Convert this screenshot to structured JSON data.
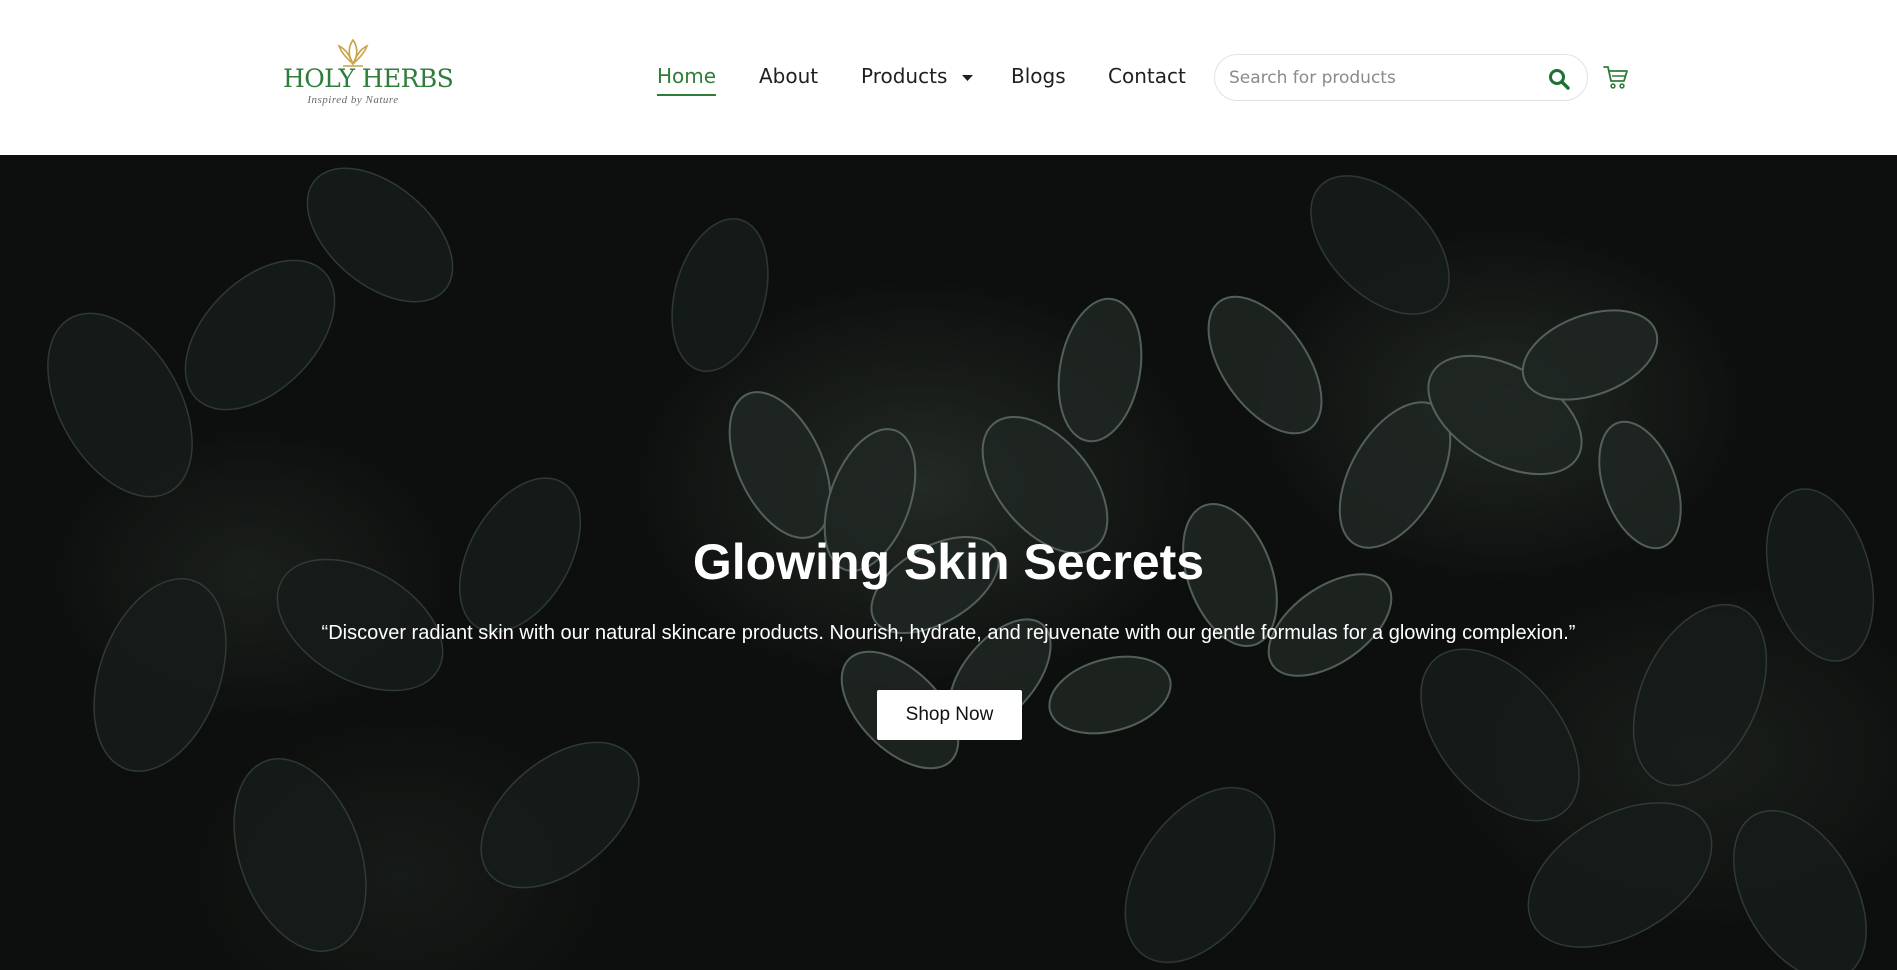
{
  "brand": {
    "name": "HOLY HERBS",
    "tagline": "Inspired by Nature",
    "accent_color": "#2e7d3a",
    "logo_icon": "lotus-leaves-icon"
  },
  "nav": {
    "items": [
      {
        "label": "Home",
        "active": true
      },
      {
        "label": "About",
        "active": false
      },
      {
        "label": "Products",
        "active": false,
        "has_dropdown": true
      },
      {
        "label": "Blogs",
        "active": false
      },
      {
        "label": "Contact",
        "active": false
      }
    ]
  },
  "search": {
    "placeholder": "Search for products",
    "value": "",
    "icon": "search-icon"
  },
  "cart": {
    "icon": "cart-icon"
  },
  "hero": {
    "title": "Glowing Skin Secrets",
    "subtitle": "“Discover radiant skin with our natural skincare products. Nourish, hydrate, and rejuvenate with our gentle formulas for a glowing complexion.”",
    "cta_label": "Shop Now"
  }
}
